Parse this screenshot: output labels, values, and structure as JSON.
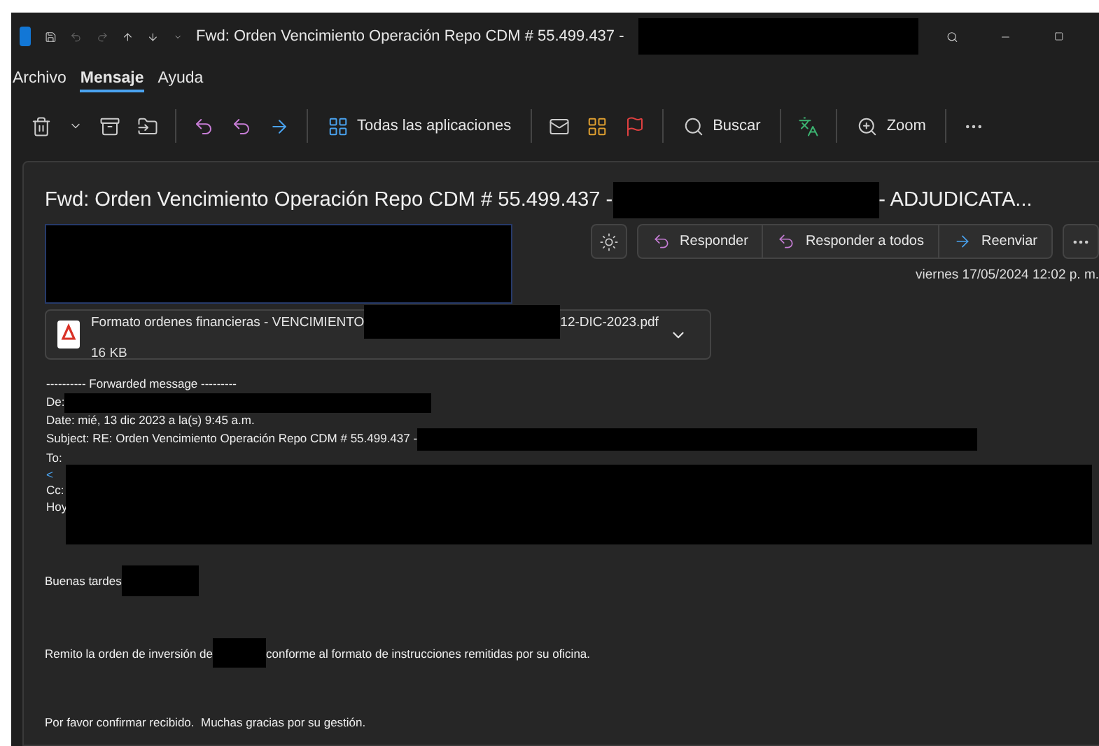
{
  "window": {
    "title": "Fwd: Orden Vencimiento Operación Repo CDM # 55.499.437 -"
  },
  "menu_tabs": [
    {
      "label": "Archivo",
      "selected": false
    },
    {
      "label": "Mensaje",
      "selected": true
    },
    {
      "label": "Ayuda",
      "selected": false
    }
  ],
  "ribbon": {
    "apps_label": "Todas las aplicaciones",
    "search_label": "Buscar",
    "zoom_label": "Zoom"
  },
  "message": {
    "subject_start": "Fwd: Orden Vencimiento Operación Repo CDM # 55.499.437 -",
    "subject_end": "- ADJUDICATA...",
    "actions": [
      "Responder",
      "Responder a todos",
      "Reenviar"
    ],
    "date": "viernes 17/05/2024 12:02 p. m.",
    "attachment": {
      "name_start": "Formato ordenes financieras - VENCIMIENTO",
      "name_end": "12-DIC-2023.pdf",
      "size": "16 KB"
    },
    "forwarded": {
      "marker": "---------- Forwarded message ---------",
      "from": "De:",
      "date": "Date: mié, 13 dic 2023 a la(s) 9:45 a.m.",
      "subject": "Subject: RE: Orden Vencimiento Operación Repo CDM # 55.499.437 -",
      "to": "To:",
      "link": "<",
      "cc": "Cc:",
      "extra": "Hoy"
    },
    "body": {
      "greeting": "Buenas tardes",
      "remit_start": "Remito la orden de inversión de",
      "remit_end": "conforme al formato de instrucciones remitidas por su oficina.",
      "closing": "Por favor confirmar recibido.  Muchas gracias por su gestión."
    }
  }
}
